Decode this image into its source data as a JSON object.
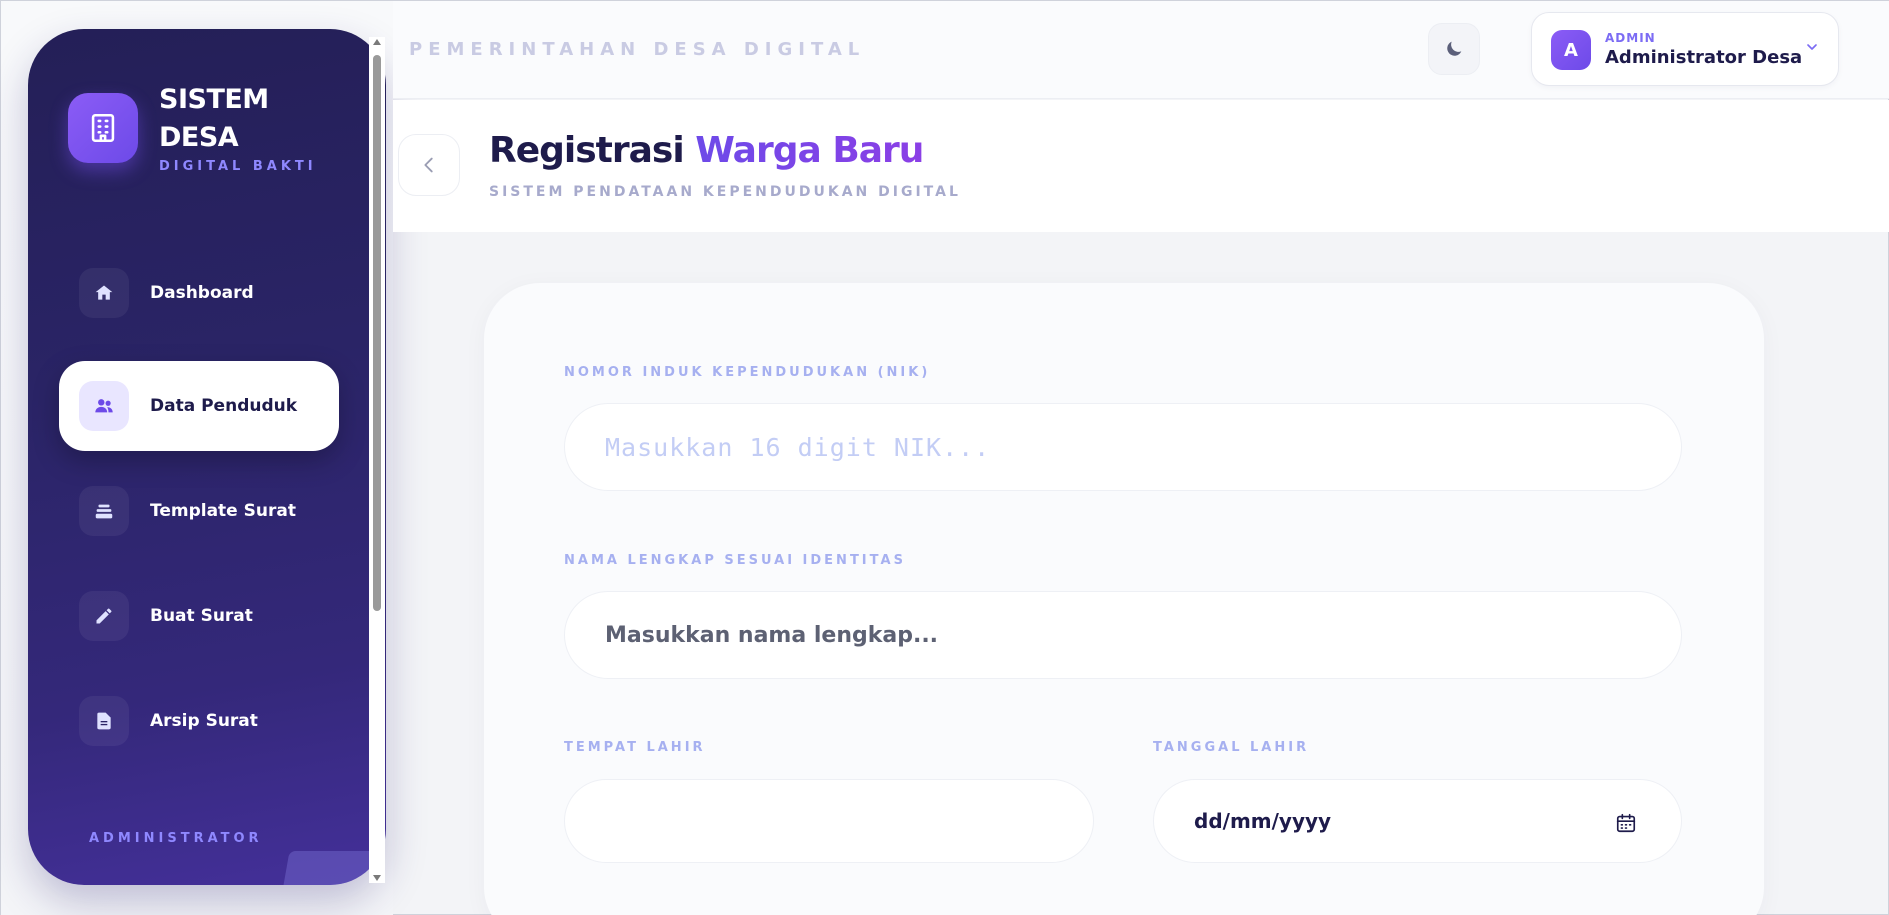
{
  "brand": {
    "title": "SISTEM DESA",
    "subtitle": "DIGITAL BAKTI"
  },
  "sidebar": {
    "items": [
      {
        "label": "Dashboard",
        "icon": "home-icon",
        "active": false
      },
      {
        "label": "Data Penduduk",
        "icon": "users-icon",
        "active": true
      },
      {
        "label": "Template Surat",
        "icon": "stack-icon",
        "active": false
      },
      {
        "label": "Buat Surat",
        "icon": "pencil-icon",
        "active": false
      },
      {
        "label": "Arsip Surat",
        "icon": "document-icon",
        "active": false
      }
    ],
    "footer_label": "ADMINISTRATOR"
  },
  "topbar": {
    "title": "PEMERINTAHAN DESA DIGITAL",
    "theme_icon": "moon-icon",
    "user": {
      "avatar_initial": "A",
      "role": "ADMIN",
      "name": "Administrator Desa"
    }
  },
  "page": {
    "title_part1": "Registrasi",
    "title_part2": "Warga Baru",
    "subtitle": "SISTEM PENDATAAN KEPENDUDUKAN DIGITAL"
  },
  "form": {
    "nik": {
      "label": "NOMOR INDUK KEPENDUDUKAN (NIK)",
      "placeholder": "Masukkan 16 digit NIK..."
    },
    "nama": {
      "label": "NAMA LENGKAP SESUAI IDENTITAS",
      "placeholder": "Masukkan nama lengkap..."
    },
    "tempat_lahir": {
      "label": "TEMPAT LAHIR",
      "value": ""
    },
    "tanggal_lahir": {
      "label": "TANGGAL LAHIR",
      "placeholder": "dd/mm/yyyy"
    }
  },
  "colors": {
    "accent": "#6d4ae8",
    "sidebar_bg": "#2a2466",
    "label": "#a6b0f0"
  }
}
